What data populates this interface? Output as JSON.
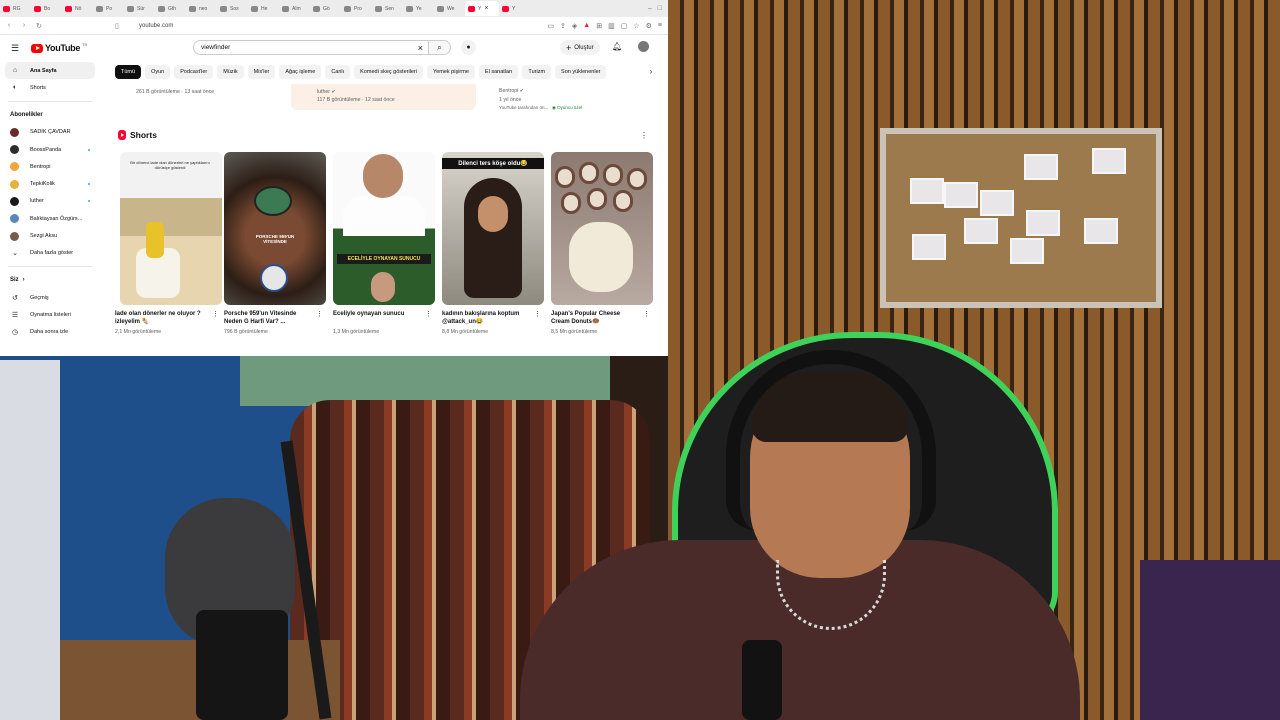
{
  "browser": {
    "tabs": [
      {
        "label": "RG",
        "icon": "youtube-icon"
      },
      {
        "label": "Bo",
        "icon": "youtube-icon"
      },
      {
        "label": "Nö",
        "icon": "youtube-icon"
      },
      {
        "label": "Po",
        "icon": "page-icon"
      },
      {
        "label": "Sür",
        "icon": "page-icon"
      },
      {
        "label": "Gth",
        "icon": "page-icon"
      },
      {
        "label": "neo",
        "icon": "google-icon"
      },
      {
        "label": "Sos",
        "icon": "page-icon"
      },
      {
        "label": "He",
        "icon": "page-icon"
      },
      {
        "label": "Alm",
        "icon": "page-icon"
      },
      {
        "label": "Gö",
        "icon": "page-icon"
      },
      {
        "label": "Pro",
        "icon": "page-icon"
      },
      {
        "label": "Sen",
        "icon": "page-icon"
      },
      {
        "label": "Ye",
        "icon": "page-icon"
      },
      {
        "label": "We",
        "icon": "page-icon"
      },
      {
        "label": "Y",
        "icon": "youtube-icon",
        "active": true
      },
      {
        "label": "Y",
        "icon": "youtube-icon"
      }
    ],
    "url": "youtube.com"
  },
  "youtube": {
    "logo_text": "YouTube",
    "country_code": "TR",
    "search_value": "viewfinder",
    "create_label": "Oluştur",
    "sidebar": {
      "main": [
        {
          "label": "Ana Sayfa",
          "icon": "home-icon",
          "active": true
        },
        {
          "label": "Shorts",
          "icon": "shorts-icon"
        }
      ],
      "subscriptions_heading": "Abonelikler",
      "subscriptions": [
        {
          "label": "SADIK ÇAVDAR",
          "dot": false
        },
        {
          "label": "BoossPanda",
          "dot": true
        },
        {
          "label": "Bentropi",
          "dot": false
        },
        {
          "label": "TepkiKolik",
          "dot": true
        },
        {
          "label": "luther",
          "dot": true
        },
        {
          "label": "Balıktaysan Özgürs...",
          "dot": false
        },
        {
          "label": "Sezgi Aksu",
          "dot": false
        }
      ],
      "show_more": "Daha fazla göster",
      "you_heading": "Siz",
      "you_items": [
        {
          "label": "Geçmiş",
          "icon": "history-icon"
        },
        {
          "label": "Oynatma listeleri",
          "icon": "playlist-icon"
        },
        {
          "label": "Daha sonra izle",
          "icon": "clock-icon"
        }
      ]
    },
    "chips": [
      "Tümü",
      "Oyun",
      "Podcast'ler",
      "Müzik",
      "Mix'ler",
      "Ağaç işleme",
      "Canlı",
      "Komedi skeç gösterileri",
      "Yemek pişirme",
      "El sanatları",
      "Turizm",
      "Son yüklenenler"
    ],
    "previous_row": {
      "left_meta": "261 B görüntüleme · 13 saat önce",
      "middle_channel": "luther",
      "middle_meta": "117 B görüntüleme · 12 saat önce",
      "right_channel": "Bentropi",
      "right_time": "1 yıl önce",
      "right_note": "YouTube tarafından ön...",
      "right_badge": "Oyuncu özel"
    },
    "shorts_heading": "Shorts",
    "shorts": [
      {
        "title": "İade olan dönerler ne oluyor ? izleyelim 🌯",
        "views": "2,1 Mn görüntüleme",
        "thumb_caption": "Bir dönerci iade olan dönerleri ne yaptıklarını dürüstçe gösterdi"
      },
      {
        "title": "Porsche 959'un Vitesinde Neden G Harfi Var? ...",
        "views": "796 B görüntüleme",
        "thumb_caption": "PORSCHE 959'UN VİTESİNDE"
      },
      {
        "title": "Eceliyle oynayan sunucu",
        "views": "1,3 Mn görüntüleme",
        "thumb_caption": "ECELİYLE OYNAYAN SUNUCU"
      },
      {
        "title": "kadının bakışlarına koptum @attack_un😂",
        "views": "8,8 Mn görüntüleme",
        "thumb_caption": "Dilenci ters köşe oldu😂"
      },
      {
        "title": "Japan's Popular Cheese Cream Donuts🍩",
        "views": "8,5 Mn görüntüleme",
        "thumb_caption": ""
      }
    ]
  },
  "colors": {
    "brand_red": "#ff0000",
    "chip_selected": "#0f0f0f",
    "headset_accent": "#3fd25a"
  }
}
